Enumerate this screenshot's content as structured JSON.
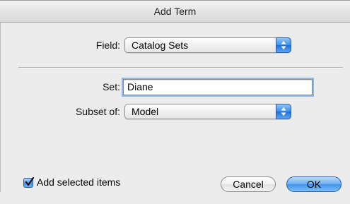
{
  "window": {
    "title": "Add Term"
  },
  "field": {
    "label": "Field:",
    "value": "Catalog Sets"
  },
  "set": {
    "label": "Set:",
    "value": "Diane"
  },
  "subset": {
    "label": "Subset of:",
    "value": "Model"
  },
  "checkbox": {
    "label": "Add selected items",
    "checked": true
  },
  "buttons": {
    "cancel": "Cancel",
    "ok": "OK"
  },
  "colors": {
    "accent": "#3d8fea",
    "background": "#ececec"
  },
  "icons": {
    "popup": "up-down-arrows-icon",
    "check": "checkmark-icon"
  }
}
